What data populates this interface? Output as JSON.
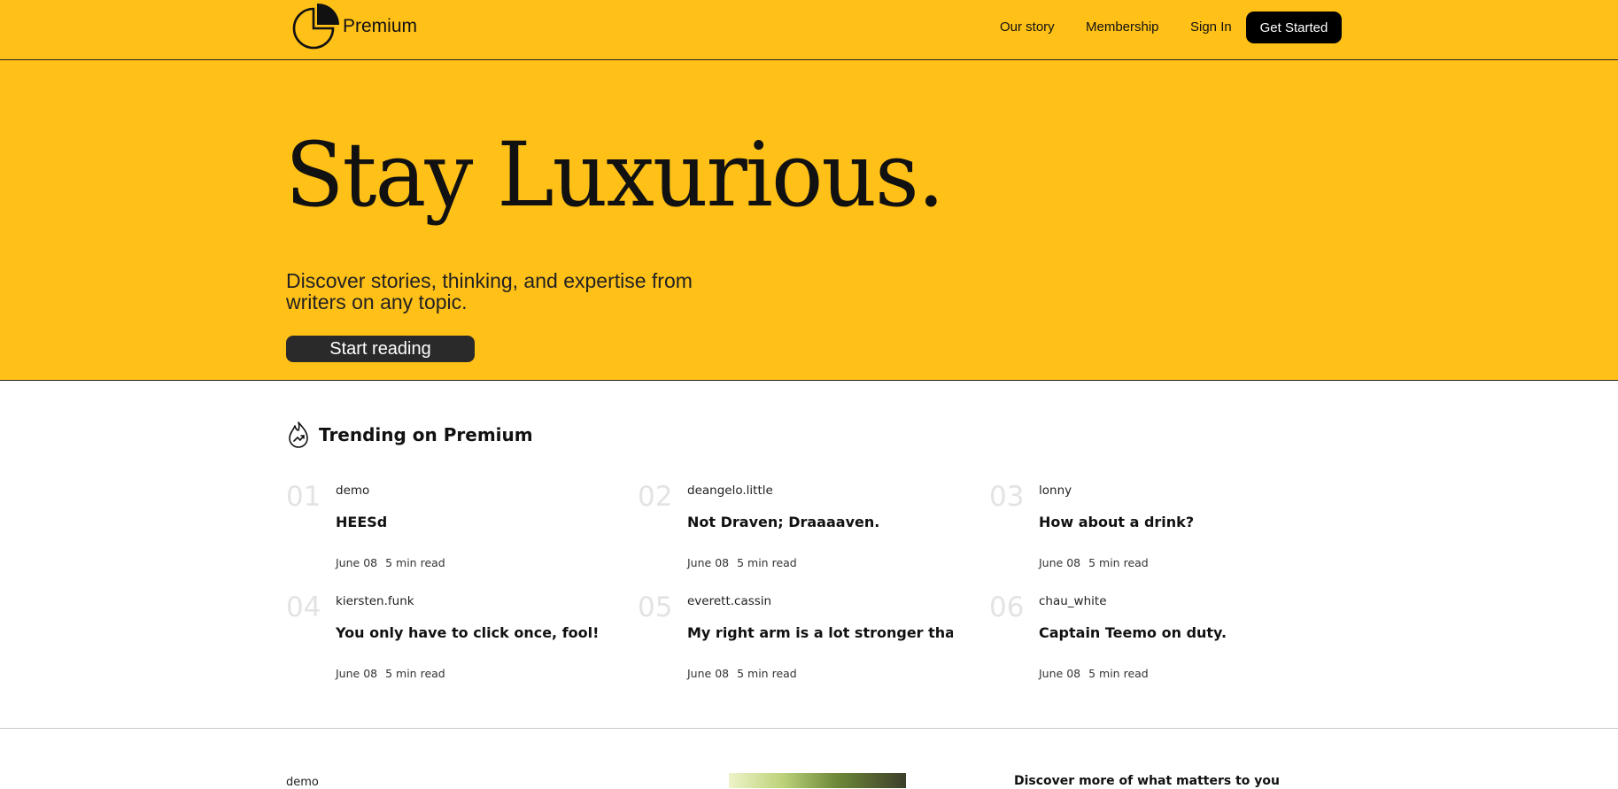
{
  "header": {
    "brand": "Premium",
    "nav": [
      "Our story",
      "Membership",
      "Sign In"
    ],
    "cta": "Get Started"
  },
  "hero": {
    "title": "Stay Luxurious.",
    "subtitle": "Discover stories, thinking, and expertise from writers on any topic.",
    "button": "Start reading"
  },
  "trending": {
    "heading": "Trending on Premium",
    "items": [
      {
        "num": "01",
        "author": "demo",
        "title": "HEESd",
        "date": "June 08",
        "read": "5 min read"
      },
      {
        "num": "02",
        "author": "deangelo.little",
        "title": "Not Draven; Draaaaven.",
        "date": "June 08",
        "read": "5 min read"
      },
      {
        "num": "03",
        "author": "lonny",
        "title": "How about a drink?",
        "date": "June 08",
        "read": "5 min read"
      },
      {
        "num": "04",
        "author": "kiersten.funk",
        "title": "You only have to click once, fool!",
        "date": "June 08",
        "read": "5 min read"
      },
      {
        "num": "05",
        "author": "everett.cassin",
        "title": "My right arm is a lot stronger than my left arm.",
        "date": "June 08",
        "read": "5 min read"
      },
      {
        "num": "06",
        "author": "chau_white",
        "title": "Captain Teemo on duty.",
        "date": "June 08",
        "read": "5 min read"
      }
    ]
  },
  "feed": {
    "first_author": "demo",
    "discover_heading": "Discover more of what matters to you"
  },
  "colors": {
    "brand_yellow": "#ffc017",
    "button_dark": "#2a2a2a",
    "number_gray": "#e3e3e3"
  },
  "icons": {
    "logo": "pie-chart-logo-icon",
    "trending": "trending-flame-icon"
  }
}
